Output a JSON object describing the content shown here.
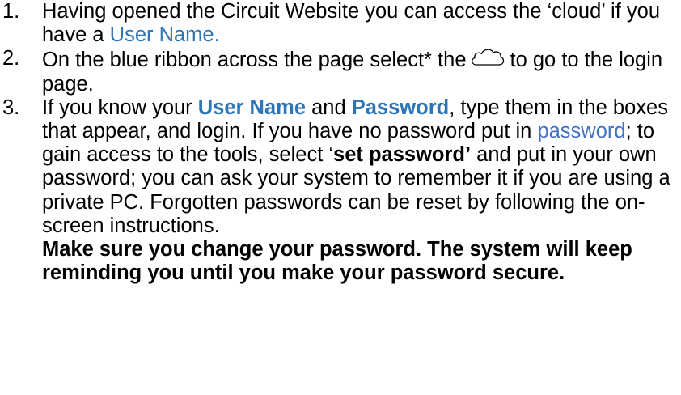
{
  "steps": [
    {
      "number": "1.",
      "text_a": "Having opened the Circuit Website you can access the ‘cloud’ if you have a ",
      "link_username": "User Name."
    },
    {
      "number": "2.",
      "text_a": "On the blue ribbon across the page select* the",
      "icon": "cloud-icon",
      "text_b": "to go to  the login page."
    },
    {
      "number": "3.",
      "text_a": "If you know your ",
      "bold_username": "User Name",
      "text_and": " and ",
      "bold_password": "Password",
      "text_b": ", type them in the boxes that appear, and login. If you have no password put in ",
      "link_password": "password",
      "text_c": "; to gain access to the tools, select  ‘",
      "bold_set_password": "set password’",
      "text_d": " and put in your own password; you can ask your system to remember it if you are using a private PC. Forgotten passwords can be reset by following the on-screen instructions.",
      "warning": "Make sure you change your password. The system will keep reminding you until you make your password secure."
    }
  ]
}
